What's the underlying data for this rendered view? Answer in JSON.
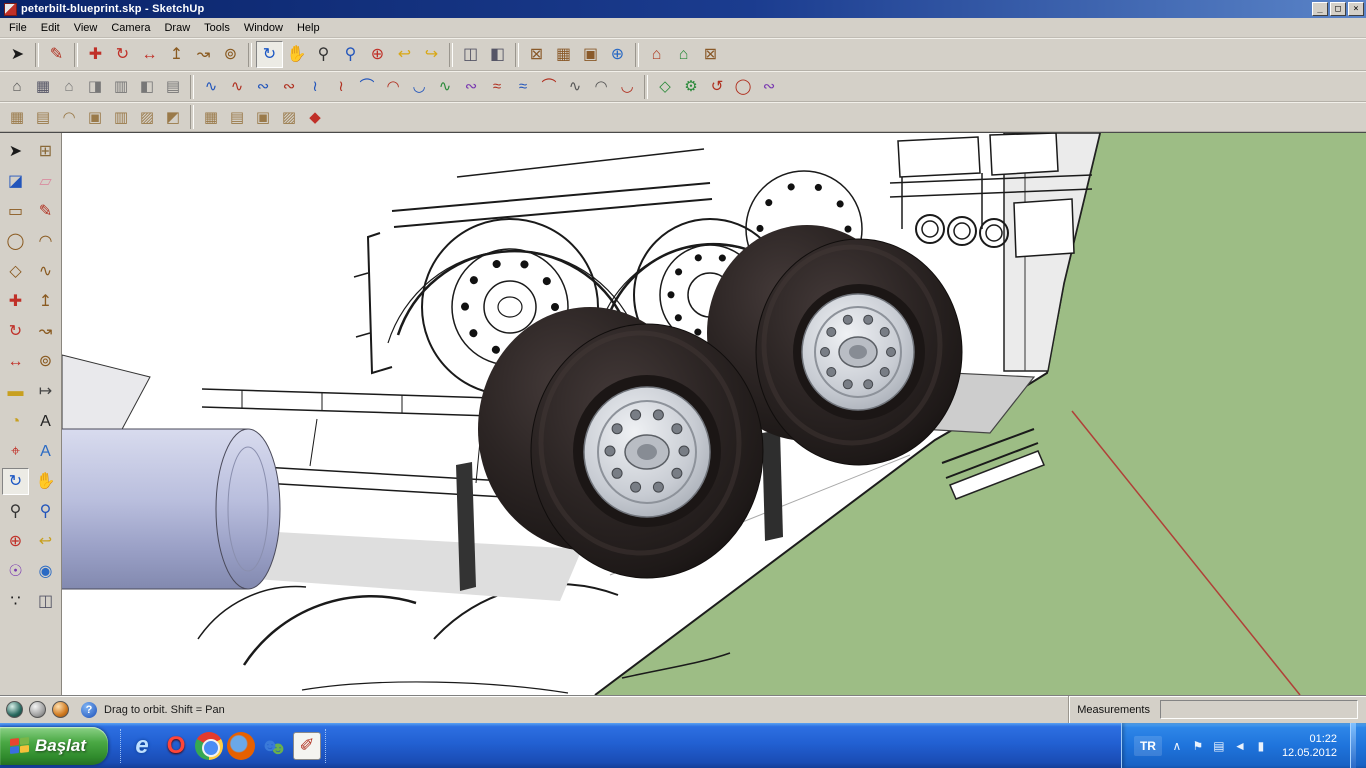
{
  "window": {
    "title": "peterbilt-blueprint.skp - SketchUp",
    "minimize_glyph": "_",
    "maximize_glyph": "□",
    "close_glyph": "×"
  },
  "menu": {
    "items": [
      {
        "name": "menu-file",
        "label": "File"
      },
      {
        "name": "menu-edit",
        "label": "Edit"
      },
      {
        "name": "menu-view",
        "label": "View"
      },
      {
        "name": "menu-camera",
        "label": "Camera"
      },
      {
        "name": "menu-draw",
        "label": "Draw"
      },
      {
        "name": "menu-tools",
        "label": "Tools"
      },
      {
        "name": "menu-window",
        "label": "Window"
      },
      {
        "name": "menu-help",
        "label": "Help"
      }
    ]
  },
  "toolbars": {
    "row1": [
      {
        "name": "select-tool-button",
        "glyph": "➤",
        "color": "#1a1a1a"
      },
      {
        "sep": true
      },
      {
        "name": "line-tool-button",
        "glyph": "✎",
        "color": "#b03020"
      },
      {
        "sep": true
      },
      {
        "name": "move-tool-button",
        "glyph": "✚",
        "color": "#c03028"
      },
      {
        "name": "rotate-tool-button",
        "glyph": "↻",
        "color": "#c03028"
      },
      {
        "name": "scale-tool-button",
        "glyph": "↔",
        "color": "#c03028"
      },
      {
        "name": "push-pull-tool-button",
        "glyph": "↥",
        "color": "#8a5a20"
      },
      {
        "name": "follow-me-tool-button",
        "glyph": "↝",
        "color": "#8a5a20"
      },
      {
        "name": "offset-tool-button",
        "glyph": "⊚",
        "color": "#8a5a20"
      },
      {
        "sep": true
      },
      {
        "name": "orbit-tool-button",
        "glyph": "↻",
        "color": "#1a56c4",
        "pressed": true
      },
      {
        "name": "pan-tool-button",
        "glyph": "✋",
        "color": "#c8a048"
      },
      {
        "name": "zoom-tool-button",
        "glyph": "⚲",
        "color": "#333333"
      },
      {
        "name": "zoom-window-tool-button",
        "glyph": "⚲",
        "color": "#2255bb"
      },
      {
        "name": "zoom-extents-button",
        "glyph": "⊕",
        "color": "#c03028"
      },
      {
        "name": "previous-view-button",
        "glyph": "↩",
        "color": "#d8a818"
      },
      {
        "name": "next-view-button",
        "glyph": "↪",
        "color": "#d8a818"
      },
      {
        "sep": true
      },
      {
        "name": "section-plane-tool-button",
        "glyph": "◫",
        "color": "#555566"
      },
      {
        "name": "section-cuts-toggle-button",
        "glyph": "◧",
        "color": "#555566"
      },
      {
        "sep": true
      },
      {
        "name": "get-current-view-button",
        "glyph": "⊠",
        "color": "#8a5a2a"
      },
      {
        "name": "toggle-terrain-button",
        "glyph": "▦",
        "color": "#8a5a2a"
      },
      {
        "name": "photo-textures-button",
        "glyph": "▣",
        "color": "#8a5a2a"
      },
      {
        "name": "preview-in-google-earth-button",
        "glyph": "⊕",
        "color": "#2a6ac4"
      },
      {
        "sep": true
      },
      {
        "name": "get-models-button",
        "glyph": "⌂",
        "color": "#b04028"
      },
      {
        "name": "share-model-button",
        "glyph": "⌂",
        "color": "#2a8a3a"
      },
      {
        "name": "components-button",
        "glyph": "⊠",
        "color": "#8a5a2a"
      }
    ],
    "row2": [
      {
        "name": "iso-view-button",
        "glyph": "⌂",
        "color": "#555555"
      },
      {
        "name": "top-view-button",
        "glyph": "▦",
        "color": "#556"
      },
      {
        "name": "front-view-button",
        "glyph": "⌂",
        "color": "#777777"
      },
      {
        "name": "right-view-button",
        "glyph": "◨",
        "color": "#777777"
      },
      {
        "name": "back-view-button",
        "glyph": "▥",
        "color": "#777777"
      },
      {
        "name": "left-view-button",
        "glyph": "◧",
        "color": "#777777"
      },
      {
        "name": "bottom-view-button",
        "glyph": "▤",
        "color": "#777777"
      },
      {
        "sep": true
      },
      {
        "name": "bezier-classic-tool-button",
        "glyph": "∿",
        "color": "#2255bb"
      },
      {
        "name": "rational-bezier-tool-button",
        "glyph": "∿",
        "color": "#b03020"
      },
      {
        "name": "cubic-bezier-tool-button",
        "glyph": "∾",
        "color": "#2255bb"
      },
      {
        "name": "uniform-bspline-tool-button",
        "glyph": "∾",
        "color": "#b03020"
      },
      {
        "name": "quadratic-bspline-tool-button",
        "glyph": "≀",
        "color": "#2255bb"
      },
      {
        "name": "catmull-rom-tool-button",
        "glyph": "≀",
        "color": "#b03020"
      },
      {
        "name": "f-spline-tool-button",
        "glyph": "⌒",
        "color": "#2255bb"
      },
      {
        "name": "bezier-polyline-tool-button",
        "glyph": "◠",
        "color": "#b03020"
      },
      {
        "name": "arc-polyline-tool-button",
        "glyph": "◡",
        "color": "#2255bb"
      },
      {
        "name": "segment-curve-tool-button",
        "glyph": "∿",
        "color": "#2a8a3a"
      },
      {
        "name": "curvy-polyline-tool-button",
        "glyph": "∾",
        "color": "#7a3ab0"
      },
      {
        "name": "spiral-curve-tool-button",
        "glyph": "≈",
        "color": "#b03020"
      },
      {
        "name": "interpolate-curve-tool-button",
        "glyph": "≈",
        "color": "#2255bb"
      },
      {
        "name": "smooth-curve-tool-button",
        "glyph": "⌒",
        "color": "#b03020"
      },
      {
        "name": "edit-curve-tool-button",
        "glyph": "∿",
        "color": "#555555"
      },
      {
        "name": "convert-curve-tool-button",
        "glyph": "◠",
        "color": "#555555"
      },
      {
        "name": "divide-curve-tool-button",
        "glyph": "◡",
        "color": "#b03020"
      },
      {
        "sep": true
      },
      {
        "name": "polygon-shape-tool-button",
        "glyph": "◇",
        "color": "#2a8a3a"
      },
      {
        "name": "wrench-settings-button",
        "glyph": "⚙",
        "color": "#2a8a3a"
      },
      {
        "name": "loop-shape-tool-button",
        "glyph": "↺",
        "color": "#b03020"
      },
      {
        "name": "oval-shape-tool-button",
        "glyph": "◯",
        "color": "#b03020"
      },
      {
        "name": "freeform-shape-tool-button",
        "glyph": "∾",
        "color": "#7a3ab0"
      }
    ],
    "row3": [
      {
        "name": "sandbox-from-contours-button",
        "glyph": "▦",
        "color": "#9a7a4a"
      },
      {
        "name": "sandbox-from-scratch-button",
        "glyph": "▤",
        "color": "#9a7a4a"
      },
      {
        "name": "sandbox-smoove-button",
        "glyph": "◠",
        "color": "#9a7a4a"
      },
      {
        "name": "sandbox-stamp-button",
        "glyph": "▣",
        "color": "#9a7a4a"
      },
      {
        "name": "sandbox-drape-button",
        "glyph": "▥",
        "color": "#9a7a4a"
      },
      {
        "name": "sandbox-add-detail-button",
        "glyph": "▨",
        "color": "#9a7a4a"
      },
      {
        "name": "sandbox-flip-edge-button",
        "glyph": "◩",
        "color": "#9a7a4a"
      },
      {
        "sep": true
      },
      {
        "name": "terrain-grid-button",
        "glyph": "▦",
        "color": "#9a7a4a"
      },
      {
        "name": "terrain-mesh-button",
        "glyph": "▤",
        "color": "#9a7a4a"
      },
      {
        "name": "terrain-vertex-edit-button",
        "glyph": "▣",
        "color": "#9a7a4a"
      },
      {
        "name": "terrain-erase-button",
        "glyph": "▨",
        "color": "#9a7a4a"
      },
      {
        "name": "terrain-triangulate-button",
        "glyph": "◆",
        "color": "#c03028"
      }
    ]
  },
  "sidebar": {
    "tools": [
      {
        "name": "select-tool",
        "glyph": "➤",
        "color": "#1a1a1a"
      },
      {
        "name": "make-component-tool",
        "glyph": "⊞",
        "color": "#8a6a3a"
      },
      {
        "name": "paint-bucket-tool",
        "glyph": "◪",
        "color": "#2255bb"
      },
      {
        "name": "eraser-tool",
        "glyph": "▱",
        "color": "#d98ca0"
      },
      {
        "name": "rectangle-tool",
        "glyph": "▭",
        "color": "#8a5a20"
      },
      {
        "name": "line-tool",
        "glyph": "✎",
        "color": "#b03020"
      },
      {
        "name": "circle-tool",
        "glyph": "◯",
        "color": "#8a5a20"
      },
      {
        "name": "arc-tool",
        "glyph": "◠",
        "color": "#8a5a20"
      },
      {
        "name": "polygon-tool",
        "glyph": "◇",
        "color": "#8a5a20"
      },
      {
        "name": "freehand-tool",
        "glyph": "∿",
        "color": "#8a5a20"
      },
      {
        "name": "move-tool",
        "glyph": "✚",
        "color": "#c03028"
      },
      {
        "name": "push-pull-tool",
        "glyph": "↥",
        "color": "#8a5a20"
      },
      {
        "name": "rotate-tool",
        "glyph": "↻",
        "color": "#c03028"
      },
      {
        "name": "follow-me-tool",
        "glyph": "↝",
        "color": "#8a5a20"
      },
      {
        "name": "scale-tool",
        "glyph": "↔",
        "color": "#c03028"
      },
      {
        "name": "offset-tool",
        "glyph": "⊚",
        "color": "#8a5a20"
      },
      {
        "name": "tape-measure-tool",
        "glyph": "▬",
        "color": "#c8a020"
      },
      {
        "name": "dimension-tool",
        "glyph": "↦",
        "color": "#444444"
      },
      {
        "name": "protractor-tool",
        "glyph": "◔",
        "color": "#c8a020"
      },
      {
        "name": "text-tool",
        "glyph": "A",
        "color": "#222222"
      },
      {
        "name": "axes-tool",
        "glyph": "⌖",
        "color": "#c03028"
      },
      {
        "name": "3d-text-tool",
        "glyph": "A",
        "color": "#2a6ac4"
      },
      {
        "name": "orbit-tool",
        "glyph": "↻",
        "color": "#1a56c4",
        "pressed": true
      },
      {
        "name": "pan-tool",
        "glyph": "✋",
        "color": "#c8a048"
      },
      {
        "name": "zoom-tool",
        "glyph": "⚲",
        "color": "#333333"
      },
      {
        "name": "zoom-window-tool",
        "glyph": "⚲",
        "color": "#2255bb"
      },
      {
        "name": "zoom-extents-tool",
        "glyph": "⊕",
        "color": "#c03028"
      },
      {
        "name": "previous-view-tool",
        "glyph": "↩",
        "color": "#c8a020"
      },
      {
        "name": "position-camera-tool",
        "glyph": "☉",
        "color": "#7a3ab0"
      },
      {
        "name": "look-around-tool",
        "glyph": "◉",
        "color": "#2a6ac4"
      },
      {
        "name": "walk-tool",
        "glyph": "∵",
        "color": "#1a1a1a"
      },
      {
        "name": "section-plane-tool",
        "glyph": "◫",
        "color": "#555566"
      }
    ]
  },
  "statusbar": {
    "help_glyph": "?",
    "hint": "Drag to orbit.  Shift = Pan",
    "measurements_label": "Measurements",
    "measurements_value": ""
  },
  "taskbar": {
    "start_label": "Başlat",
    "quicklaunch": [
      {
        "name": "internet-explorer-launcher",
        "glyph": "e",
        "cls": "ql-ie"
      },
      {
        "name": "opera-launcher",
        "glyph": "O",
        "cls": "ql-opera"
      },
      {
        "name": "chrome-launcher",
        "glyph": "",
        "cls": "ql-chrome"
      },
      {
        "name": "firefox-launcher",
        "glyph": "",
        "cls": "ql-firefox"
      },
      {
        "name": "messenger-launcher",
        "glyph": "☻",
        "cls": "ql-people"
      },
      {
        "name": "notes-launcher",
        "glyph": "✐",
        "cls": "ql-pen"
      }
    ],
    "tray": {
      "lang": "TR",
      "icons": [
        {
          "name": "hidden-icons-chevron",
          "glyph": "∧"
        },
        {
          "name": "notification-flag-icon",
          "glyph": "⚑"
        },
        {
          "name": "clipboard-tray-icon",
          "glyph": "▤"
        },
        {
          "name": "volume-tray-icon",
          "glyph": "◄"
        },
        {
          "name": "network-tray-icon",
          "glyph": "▮"
        }
      ],
      "time": "01:22",
      "date": "12.05.2012"
    }
  },
  "colors": {
    "ground_green": "#9dbd85",
    "axis_red": "#b04038",
    "chrome_grey": "#d4d0c8",
    "titlebar_blue": "#0a246a"
  }
}
